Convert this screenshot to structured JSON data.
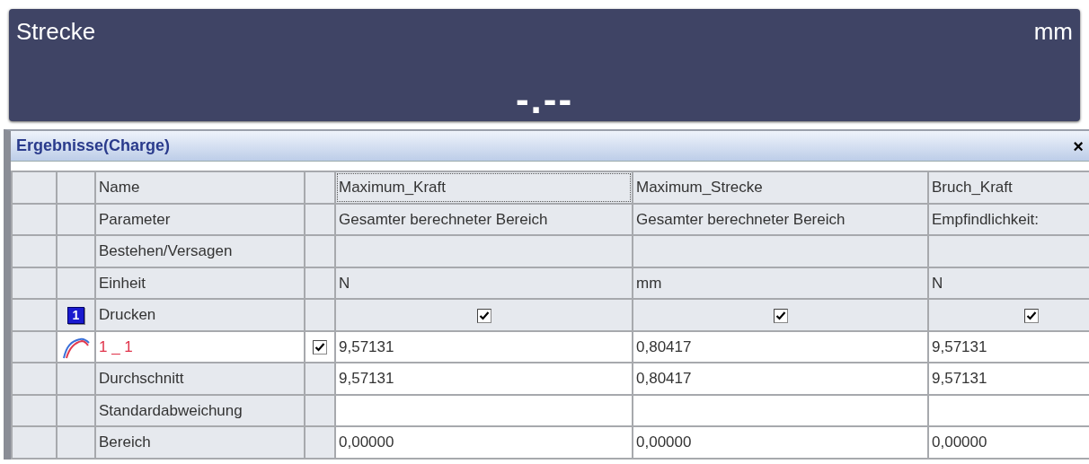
{
  "display": {
    "label": "Strecke",
    "unit": "mm",
    "value": "-.--"
  },
  "panel": {
    "title": "Ergebnisse(Charge)",
    "close": "×"
  },
  "rows": [
    {
      "kind": "info",
      "label": "Name",
      "cells": [
        "Maximum_Kraft",
        "Maximum_Strecke",
        "Bruch_Kraft"
      ],
      "focused": [
        true,
        false,
        false
      ]
    },
    {
      "kind": "info",
      "label": "Parameter",
      "cells": [
        "Gesamter berechneter Bereich",
        "Gesamter berechneter Bereich",
        "Empfindlichkeit:"
      ]
    },
    {
      "kind": "info",
      "label": "Bestehen/Versagen",
      "cells": []
    },
    {
      "kind": "info",
      "label": "Einheit",
      "cells": [
        "N",
        "mm",
        "N"
      ]
    },
    {
      "kind": "print",
      "label": "Drucken",
      "badge": "1",
      "checks": [
        true,
        true,
        true
      ]
    },
    {
      "kind": "sample",
      "label": "1 _ 1",
      "checked": true,
      "cells": [
        "9,57131",
        "0,80417",
        "9,57131"
      ]
    },
    {
      "kind": "stat",
      "label": "Durchschnitt",
      "cells": [
        "9,57131",
        "0,80417",
        "9,57131"
      ]
    },
    {
      "kind": "stat",
      "label": "Standardabweichung",
      "cells": []
    },
    {
      "kind": "stat",
      "label": "Bereich",
      "cells": [
        "0,00000",
        "0,00000",
        "0,00000"
      ]
    }
  ]
}
